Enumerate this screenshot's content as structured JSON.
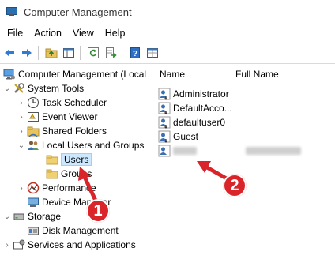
{
  "window": {
    "title": "Computer Management"
  },
  "menu": [
    {
      "label": "File"
    },
    {
      "label": "Action"
    },
    {
      "label": "View"
    },
    {
      "label": "Help"
    }
  ],
  "toolbar": {
    "buttons": [
      "back-icon",
      "forward-icon",
      "up-folder-icon",
      "show-hide-tree-icon",
      "refresh-icon",
      "export-list-icon",
      "help-icon",
      "properties-icon"
    ]
  },
  "tree": {
    "root": "Computer Management (Local",
    "system_tools": "System Tools",
    "task_scheduler": "Task Scheduler",
    "event_viewer": "Event Viewer",
    "shared_folders": "Shared Folders",
    "local_users_groups": "Local Users and Groups",
    "users": "Users",
    "groups": "Groups",
    "performance": "Performance",
    "device_manager": "Device Manager",
    "storage": "Storage",
    "disk_management": "Disk Management",
    "services_apps": "Services and Applications"
  },
  "list": {
    "columns": [
      "Name",
      "Full Name"
    ],
    "rows": [
      {
        "name": "Administrator"
      },
      {
        "name": "DefaultAcco..."
      },
      {
        "name": "defaultuser0"
      },
      {
        "name": "Guest"
      }
    ]
  },
  "annotations": [
    {
      "label": "1"
    },
    {
      "label": "2"
    }
  ],
  "colors": {
    "annotation": "#d9242a",
    "selection": "#cce8ff"
  }
}
